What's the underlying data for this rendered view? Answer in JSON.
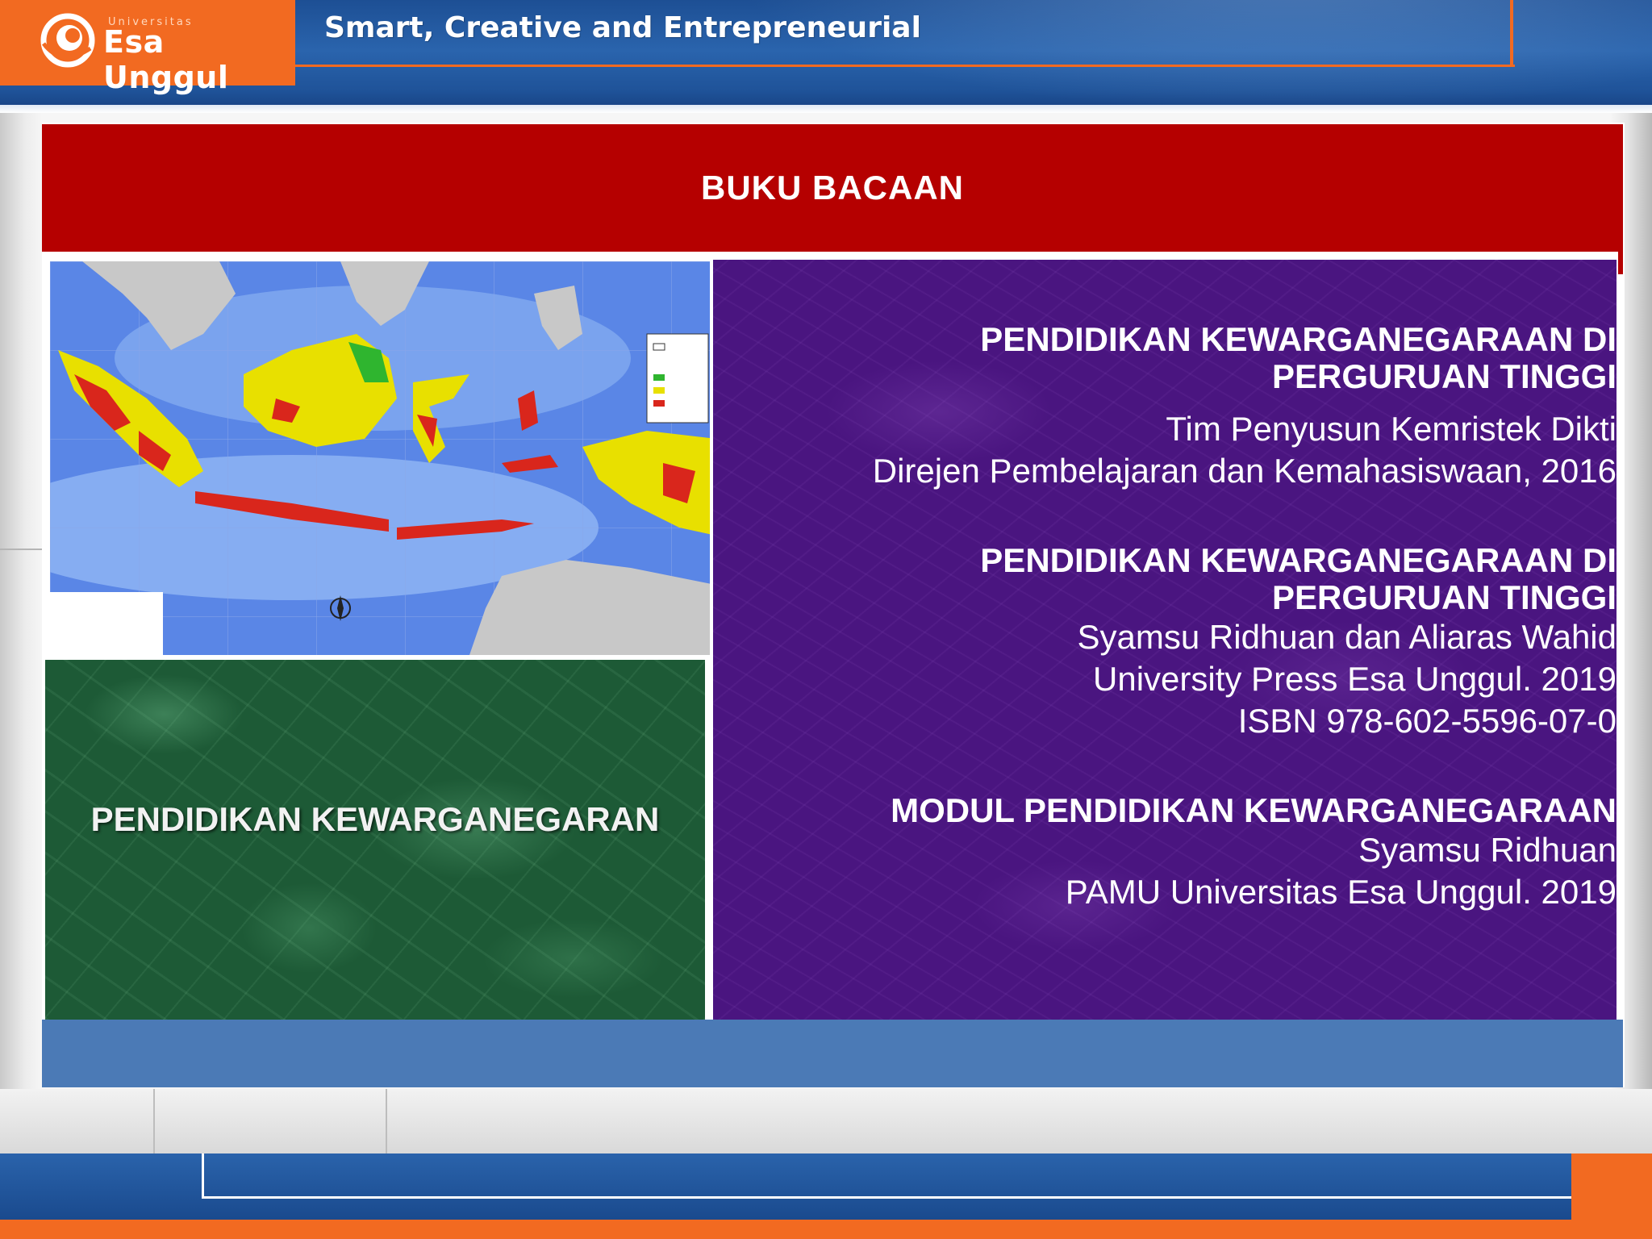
{
  "header": {
    "logo_univ": "Universitas",
    "logo_name": "Esa Unggul",
    "tagline": "Smart, Creative and Entrepreneurial"
  },
  "slide": {
    "title": "BUKU BACAAN",
    "left_label": "PENDIDIKAN KEWARGANEGARAN",
    "map_image": "map-of-indonesia",
    "books": [
      {
        "title_line1": "PENDIDIKAN KEWARGANEGARAAN DI",
        "title_line2": "PERGURUAN TINGGI",
        "lines": [
          "Tim Penyusun Kemristek Dikti",
          "Direjen Pembelajaran dan Kemahasiswaan, 2016"
        ]
      },
      {
        "title_line1": "PENDIDIKAN KEWARGANEGARAAN DI",
        "title_line2": "PERGURUAN TINGGI",
        "lines": [
          "Syamsu Ridhuan dan Aliaras Wahid",
          "University Press Esa Unggul. 2019",
          "ISBN 978-602-5596-07-0"
        ]
      },
      {
        "title_line1": "MODUL PENDIDIKAN KEWARGANEGARAAN",
        "lines": [
          "Syamsu Ridhuan",
          "PAMU Universitas Esa Unggul. 2019"
        ]
      }
    ]
  },
  "colors": {
    "brand_orange": "#f26a21",
    "brand_blue": "#1f5399",
    "title_red": "#b50000",
    "purple": "#4a1580",
    "green": "#1d5a36",
    "strip_blue": "#4b7ab6"
  }
}
